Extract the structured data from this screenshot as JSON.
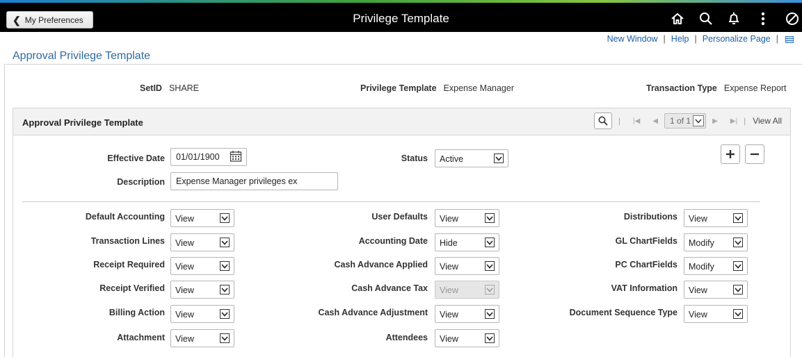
{
  "header": {
    "back_label": "My Preferences",
    "title": "Privilege Template",
    "icons": [
      "home-icon",
      "search-icon",
      "notification-bell-icon",
      "more-actions-icon",
      "navbar-icon"
    ]
  },
  "links": {
    "new_window": "New Window",
    "help": "Help",
    "personalize": "Personalize Page",
    "separator": "|"
  },
  "page_title": "Approval Privilege Template",
  "key_fields": {
    "setid_label": "SetID",
    "setid_value": "SHARE",
    "template_label": "Privilege Template",
    "template_value": "Expense Manager",
    "txn_type_label": "Transaction Type",
    "txn_type_value": "Expense Report"
  },
  "grid": {
    "title": "Approval Privilege Template",
    "pager_text": "1 of 1",
    "view_all": "View All",
    "separator": "|"
  },
  "form": {
    "effective_date_label": "Effective Date",
    "effective_date_value": "01/01/1900",
    "status_label": "Status",
    "status_value": "Active",
    "description_label": "Description",
    "description_value": "Expense Manager privileges ex",
    "add_label": "+",
    "remove_label": "−"
  },
  "privileges": {
    "col1": [
      {
        "label": "Default Accounting",
        "value": "View"
      },
      {
        "label": "Transaction Lines",
        "value": "View"
      },
      {
        "label": "Receipt Required",
        "value": "View"
      },
      {
        "label": "Receipt Verified",
        "value": "View"
      },
      {
        "label": "Billing Action",
        "value": "View"
      },
      {
        "label": "Attachment",
        "value": "View"
      }
    ],
    "col2": [
      {
        "label": "User Defaults",
        "value": "View"
      },
      {
        "label": "Accounting Date",
        "value": "Hide"
      },
      {
        "label": "Cash Advance Applied",
        "value": "View"
      },
      {
        "label": "Cash Advance Tax",
        "value": "View"
      },
      {
        "label": "Cash Advance Adjustment",
        "value": "View"
      },
      {
        "label": "Attendees",
        "value": "View"
      }
    ],
    "col3": [
      {
        "label": "Distributions",
        "value": "View"
      },
      {
        "label": "GL ChartFields",
        "value": "Modify"
      },
      {
        "label": "PC ChartFields",
        "value": "Modify"
      },
      {
        "label": "VAT Information",
        "value": "View"
      },
      {
        "label": "Document Sequence Type",
        "value": "View"
      }
    ]
  },
  "colors": {
    "header_bg": "#000000",
    "link": "#1a5ea6",
    "title": "#2f6aa1",
    "panel_head_bg": "#f2f2f2"
  }
}
